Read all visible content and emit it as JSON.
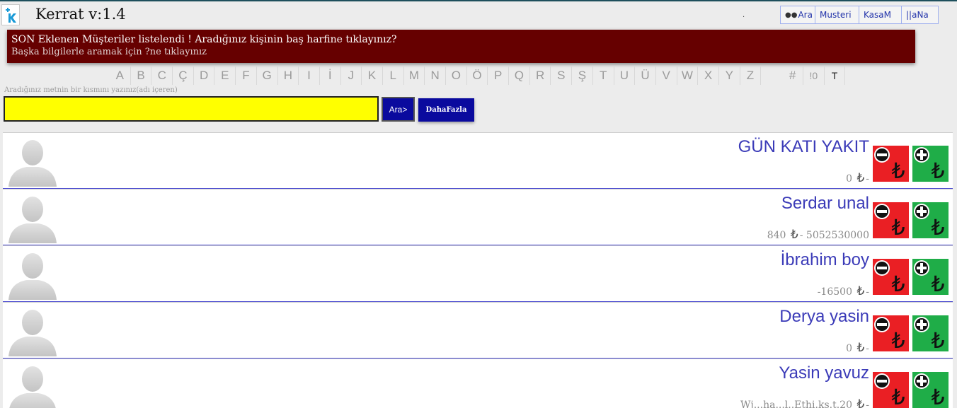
{
  "app": {
    "title": "Kerrat v:1.4",
    "dot": "."
  },
  "nav": [
    {
      "label": "Ara",
      "icon": "binoculars-icon"
    },
    {
      "label": "Musteri"
    },
    {
      "label": "KasaM"
    },
    {
      "label": "||aNa"
    }
  ],
  "notice": {
    "line1": "SON Eklenen Müşteriler listelendi ! Aradığınız kişinin baş harfine tıklayınız?",
    "line2": "Başka bilgilerle aramak için ?ne tıklayınız"
  },
  "alphabet": [
    "A",
    "B",
    "C",
    "Ç",
    "D",
    "E",
    "F",
    "G",
    "H",
    "I",
    "İ",
    "J",
    "K",
    "L",
    "M",
    "N",
    "O",
    "Ö",
    "P",
    "Q",
    "R",
    "S",
    "Ş",
    "T",
    "U",
    "Ü",
    "V",
    "W",
    "X",
    "Y",
    "Z"
  ],
  "alphabet_extra": [
    "#",
    "!0",
    "T"
  ],
  "search": {
    "hint": "Aradığınız metnin bir kısmını yazınız(adı içeren)",
    "value": "",
    "ara_label": "Ara>",
    "daha_label": "DahaFazla"
  },
  "currency_symbol": "₺",
  "customers": [
    {
      "name": "GÜN KATI YAKIT",
      "amount": "0",
      "phone": ""
    },
    {
      "name": "Serdar unal",
      "amount": "840",
      "phone": "5052530000"
    },
    {
      "name": "İbrahim boy",
      "amount": "-16500",
      "phone": ""
    },
    {
      "name": "Derya yasin",
      "amount": "0",
      "phone": ""
    },
    {
      "name": "Yasin yavuz",
      "amount": "Wj...ha...l..Ethi.ks.t.20",
      "phone": ""
    }
  ],
  "colors": {
    "notice_bg": "#660000",
    "search_bg": "#ffff00",
    "button_bg": "#0a0a9e",
    "minus_tile": "#ea1f24",
    "plus_tile": "#1fad48",
    "name_color": "#3b3bb8"
  }
}
